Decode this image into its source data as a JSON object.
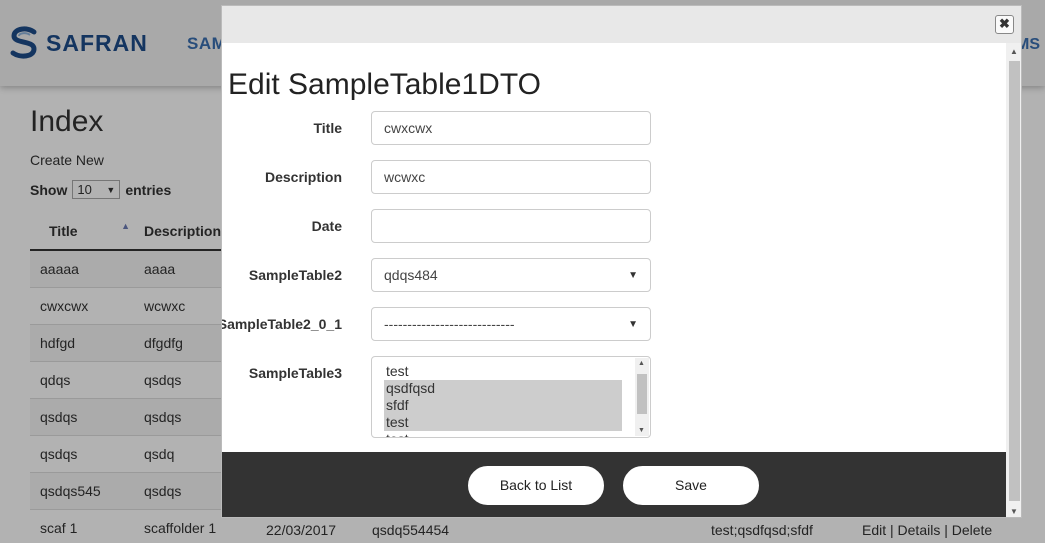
{
  "header": {
    "brand": "SAFRAN",
    "nav_left_partial": "SAMF",
    "nav_right_partial": "MS",
    "logo_color": "#1e4c8a"
  },
  "page": {
    "title": "Index",
    "create_link": "Create New",
    "show_label": "Show",
    "entries_value": "10",
    "entries_label": "entries",
    "columns": [
      "Title",
      "Description"
    ],
    "rows": [
      {
        "title": "aaaaa",
        "description": "aaaa"
      },
      {
        "title": "cwxcwx",
        "description": "wcwxc"
      },
      {
        "title": "hdfgd",
        "description": "dfgdfg"
      },
      {
        "title": "qdqs",
        "description": "qsdqs"
      },
      {
        "title": "qsdqs",
        "description": "qsdqs"
      },
      {
        "title": "qsdqs",
        "description": "qsdq"
      },
      {
        "title": "qsdqs545",
        "description": "qsdqs"
      },
      {
        "title": "scaf 1",
        "description": "scaffolder 1"
      }
    ],
    "last_row_extra": {
      "date": "22/03/2017",
      "table2": "qsdq554454",
      "table3": "test;qsdfqsd;sfdf",
      "actions": "Edit | Details | Delete"
    }
  },
  "modal": {
    "close_symbol": "✖",
    "heading": "Edit SampleTable1DTO",
    "fields": {
      "title": {
        "label": "Title",
        "value": "cwxcwx"
      },
      "description": {
        "label": "Description",
        "value": "wcwxc"
      },
      "date": {
        "label": "Date",
        "value": ""
      },
      "table2": {
        "label": "SampleTable2",
        "value": "qdqs484"
      },
      "table2_0_1": {
        "label": "SampleTable2_0_1",
        "value": "----------------------------"
      },
      "table3": {
        "label": "SampleTable3"
      }
    },
    "table3_options": [
      {
        "label": "test",
        "selected": false
      },
      {
        "label": "qsdfqsd",
        "selected": true
      },
      {
        "label": "sfdf",
        "selected": true
      },
      {
        "label": "test",
        "selected": true
      },
      {
        "label": "test",
        "selected": false
      }
    ],
    "buttons": {
      "back": "Back to List",
      "save": "Save"
    },
    "footer_color": "#333333"
  }
}
